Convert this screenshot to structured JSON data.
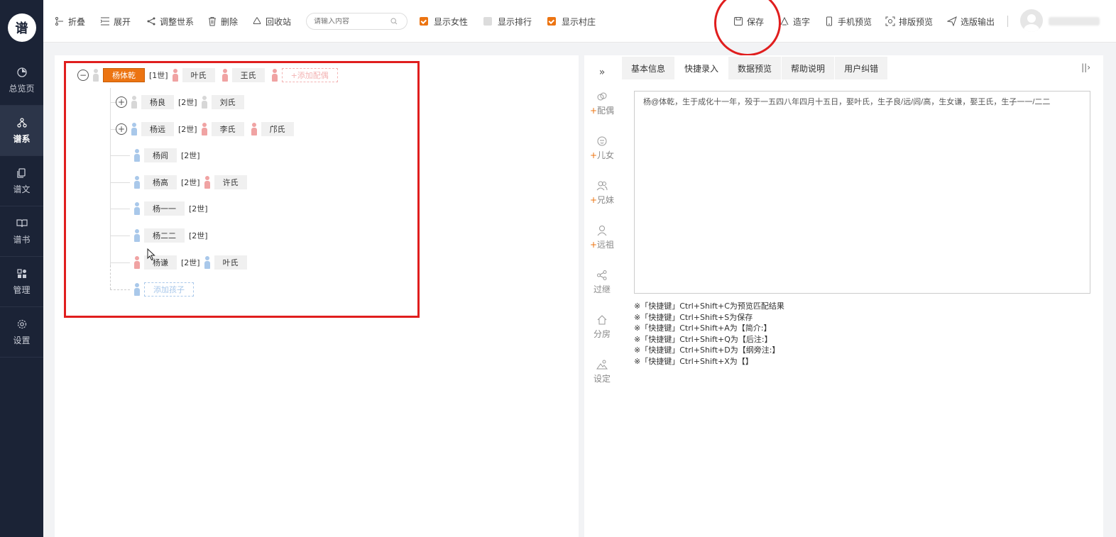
{
  "sidebar": {
    "logo_text": "谱",
    "items": [
      {
        "label": "总览页",
        "icon": "pie-chart-icon",
        "active": false
      },
      {
        "label": "谱系",
        "icon": "tree-icon",
        "active": true
      },
      {
        "label": "谱文",
        "icon": "copy-icon",
        "active": false
      },
      {
        "label": "谱书",
        "icon": "book-icon",
        "active": false
      },
      {
        "label": "管理",
        "icon": "grid-icon",
        "active": false
      },
      {
        "label": "设置",
        "icon": "gear-icon",
        "active": false
      }
    ]
  },
  "toolbar": {
    "collapse": "折叠",
    "expand": "展开",
    "adjust": "调整世系",
    "delete": "删除",
    "recycle": "回收站",
    "search_placeholder": "请输入内容",
    "show_female": "显示女性",
    "show_rank": "显示排行",
    "show_village": "显示村庄",
    "checks": {
      "show_female": true,
      "show_rank": false,
      "show_village": true
    },
    "save": "保存",
    "create_char": "造字",
    "mobile_preview": "手机预览",
    "layout_preview": "排版预览",
    "select_output": "选版输出"
  },
  "tree": {
    "root": {
      "name": "杨体乾",
      "gen": "[1世]",
      "spouses": [
        "叶氏",
        "王氏"
      ],
      "add_spouse": "+添加配偶",
      "toggle": "−"
    },
    "children": [
      {
        "name": "杨良",
        "gen": "[2世]",
        "gender": "grey",
        "toggle": "+",
        "spouses": [
          {
            "name": "刘氏",
            "gender": "grey"
          }
        ]
      },
      {
        "name": "杨远",
        "gen": "[2世]",
        "gender": "male",
        "toggle": "+",
        "spouses": [
          {
            "name": "李氏",
            "gender": "female"
          },
          {
            "name": "邝氏",
            "gender": "female"
          }
        ]
      },
      {
        "name": "杨闾",
        "gen": "[2世]",
        "gender": "male",
        "toggle": "",
        "spouses": []
      },
      {
        "name": "杨高",
        "gen": "[2世]",
        "gender": "male",
        "toggle": "",
        "spouses": [
          {
            "name": "许氏",
            "gender": "female"
          }
        ]
      },
      {
        "name": "杨一一",
        "gen": "[2世]",
        "gender": "male",
        "toggle": "",
        "spouses": []
      },
      {
        "name": "杨二二",
        "gen": "[2世]",
        "gender": "male",
        "toggle": "",
        "spouses": []
      },
      {
        "name": "杨谦",
        "gen": "[2世]",
        "gender": "female",
        "toggle": "",
        "spouses": [
          {
            "name": "叶氏",
            "gender": "male"
          }
        ]
      }
    ],
    "add_child": "添加孩子"
  },
  "tools": [
    {
      "plus": "+",
      "label": "配偶",
      "icon": "spouse-icon"
    },
    {
      "plus": "+",
      "label": "儿女",
      "icon": "child-icon"
    },
    {
      "plus": "+",
      "label": "兄妹",
      "icon": "siblings-icon"
    },
    {
      "plus": "+",
      "label": "远祖",
      "icon": "ancestor-icon"
    },
    {
      "plus": "",
      "label": "过继",
      "icon": "share-icon"
    },
    {
      "plus": "",
      "label": "分房",
      "icon": "home-icon"
    },
    {
      "plus": "",
      "label": "设定",
      "icon": "settings-icon"
    }
  ],
  "right_panel": {
    "tabs": [
      "基本信息",
      "快捷录入",
      "数据预览",
      "帮助说明",
      "用户纠错"
    ],
    "active_tab": 1,
    "text": "杨@体乾，生于成化十一年，殁于一五四八年四月十五日，娶叶氏，生子良/远/闾/高，生女谦，娶王氏，生子一一/二二",
    "hints": [
      "※「快捷键」Ctrl+Shift+C为预览匹配结果",
      "※「快捷键」Ctrl+Shift+S为保存",
      "※「快捷键」Ctrl+Shift+A为【简介:】",
      "※「快捷键」Ctrl+Shift+Q为【后注:】",
      "※「快捷键」Ctrl+Shift+D为【纲旁注:】",
      "※「快捷键」Ctrl+Shift+X为【】"
    ]
  },
  "colors": {
    "accent": "#ec7412",
    "sidebar": "#1b2336",
    "highlight": "#e01e1e"
  }
}
